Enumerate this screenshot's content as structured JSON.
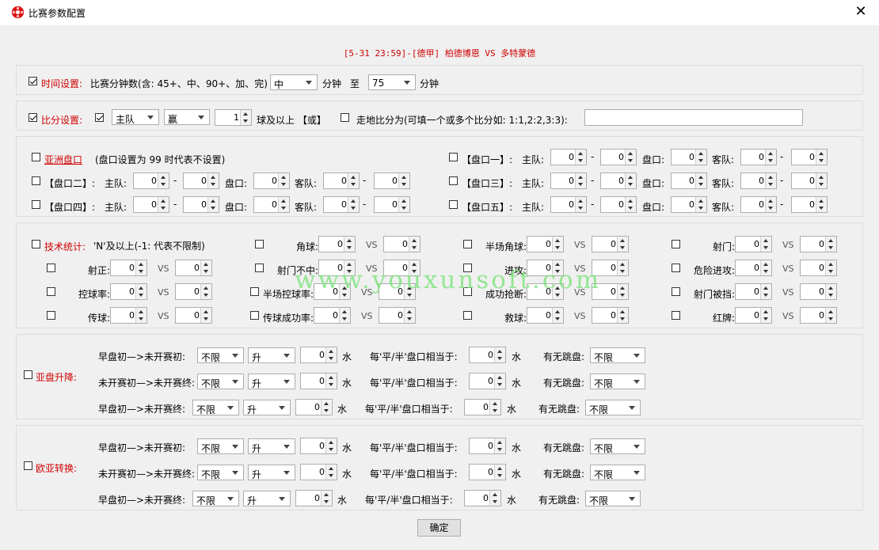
{
  "window": {
    "title": "比赛参数配置",
    "close": "✕"
  },
  "match": {
    "header": "[5-31 23:59]-[德甲] 柏德博恩 VS 多特蒙德"
  },
  "time": {
    "label": "时间设置:",
    "desc": "比赛分钟数(含: 45+、中、90+、加、完)",
    "from": "中",
    "unit1": "分钟",
    "to_label": "至",
    "to": "75",
    "unit2": "分钟"
  },
  "score": {
    "label": "比分设置:",
    "team": "主队",
    "result": "赢",
    "goals": "1",
    "suffix": "球及以上 【或】",
    "exact_label": "走地比分为(可填一个或多个比分如: 1:1,2:2,3:3):",
    "exact_value": ""
  },
  "handicap": {
    "asian_label": "亚洲盘口",
    "asian_note": "(盘口设置为 99 时代表不设置)",
    "home": "主队:",
    "line": "盘口:",
    "away": "客队:",
    "dash": "-",
    "rows": [
      {
        "label": "【盘口一】:",
        "v": [
          "0",
          "0",
          "0",
          "0",
          "0"
        ]
      },
      {
        "label": "【盘口二】:",
        "v": [
          "0",
          "0",
          "0",
          "0",
          "0"
        ]
      },
      {
        "label": "【盘口三】:",
        "v": [
          "0",
          "0",
          "0",
          "0",
          "0"
        ]
      },
      {
        "label": "【盘口四】:",
        "v": [
          "0",
          "0",
          "0",
          "0",
          "0"
        ]
      },
      {
        "label": "【盘口五】:",
        "v": [
          "0",
          "0",
          "0",
          "0",
          "0"
        ]
      }
    ]
  },
  "stats": {
    "label": "技术统计:",
    "note": "'N'及以上(-1: 代表不限制)",
    "vs": "VS",
    "items": [
      {
        "label": "角球:",
        "a": "0",
        "b": "0"
      },
      {
        "label": "半场角球:",
        "a": "0",
        "b": "0"
      },
      {
        "label": "射门:",
        "a": "0",
        "b": "0"
      },
      {
        "label": "射正:",
        "a": "0",
        "b": "0"
      },
      {
        "label": "射门不中:",
        "a": "0",
        "b": "0"
      },
      {
        "label": "进攻:",
        "a": "0",
        "b": "0"
      },
      {
        "label": "危险进攻:",
        "a": "0",
        "b": "0"
      },
      {
        "label": "控球率:",
        "a": "0",
        "b": "0"
      },
      {
        "label": "半场控球率:",
        "a": "0",
        "b": "0"
      },
      {
        "label": "成功抢断:",
        "a": "0",
        "b": "0"
      },
      {
        "label": "射门被挡:",
        "a": "0",
        "b": "0"
      },
      {
        "label": "传球:",
        "a": "0",
        "b": "0"
      },
      {
        "label": "传球成功率:",
        "a": "0",
        "b": "0"
      },
      {
        "label": "救球:",
        "a": "0",
        "b": "0"
      },
      {
        "label": "红牌:",
        "a": "0",
        "b": "0"
      }
    ]
  },
  "asia_rise": {
    "label": "亚盘升降:",
    "rows": [
      {
        "label": "早盘初—>未开赛初:",
        "limit": "不限",
        "dir": "升",
        "water": "0"
      },
      {
        "label": "未开赛初—>未开赛终:",
        "limit": "不限",
        "dir": "升",
        "water": "0"
      },
      {
        "label": "早盘初—>未开赛终:",
        "limit": "不限",
        "dir": "升",
        "water": "0"
      }
    ]
  },
  "euro_asia": {
    "label": "欧亚转换:",
    "rows": [
      {
        "label": "早盘初—>未开赛初:",
        "limit": "不限",
        "dir": "升",
        "water": "0"
      },
      {
        "label": "未开赛初—>未开赛终:",
        "limit": "不限",
        "dir": "升",
        "water": "0"
      },
      {
        "label": "早盘初—>未开赛终:",
        "limit": "不限",
        "dir": "升",
        "water": "0"
      }
    ]
  },
  "common": {
    "water_unit": "水",
    "equiv_label": "每'平/半'盘口相当于:",
    "jump_label": "有无跳盘:",
    "jump_value": "不限"
  },
  "watermark": "www.youxunsoft.com",
  "ok": "确定"
}
